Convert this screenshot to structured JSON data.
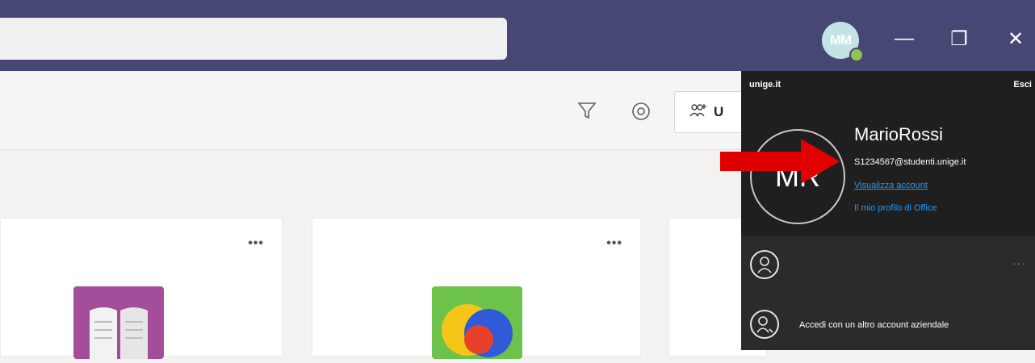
{
  "titlebar": {
    "avatar_initials": "MM",
    "presence_color": "#92c353",
    "minimize_glyph": "—",
    "maximize_glyph": "❐",
    "close_glyph": "✕"
  },
  "toolbar": {
    "filter_icon": "filter-icon",
    "settings_icon": "gear-icon",
    "manage_button_label": "U"
  },
  "cards": [
    {
      "more": "•••",
      "icon": "book-icon",
      "icon_color": "#a34d9b"
    },
    {
      "more": "•••",
      "icon": "circles-icon",
      "icon_color": "#6cc24a"
    }
  ],
  "account_panel": {
    "org": "unige.it",
    "sign_out": "Esci",
    "avatar_initials": "MR",
    "name": "MarioRossi",
    "email": "S1234567@studenti.unige.it",
    "view_account": "Visualizza account",
    "office_profile": "Il mio profilo di Office",
    "account_more": "···",
    "other_account": "Accedi con un altro account aziendale"
  },
  "colors": {
    "teams_purple": "#464775",
    "panel_dark": "#1f1f1f",
    "link_blue": "#2899f5",
    "annotation_arrow": "#e00000"
  }
}
